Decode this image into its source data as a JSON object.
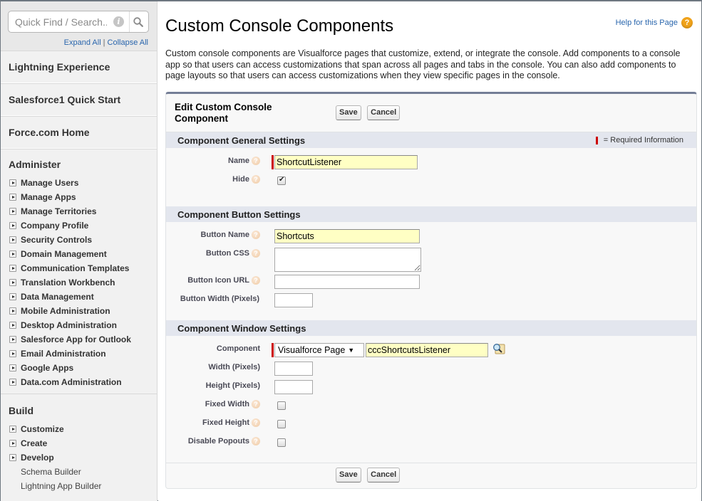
{
  "sidebar": {
    "search_placeholder": "Quick Find / Search...",
    "expand_all": "Expand All",
    "collapse_all": "Collapse All",
    "separator": "|",
    "top_links": [
      "Lightning Experience",
      "Salesforce1 Quick Start",
      "Force.com Home"
    ],
    "administer": {
      "title": "Administer",
      "items": [
        "Manage Users",
        "Manage Apps",
        "Manage Territories",
        "Company Profile",
        "Security Controls",
        "Domain Management",
        "Communication Templates",
        "Translation Workbench",
        "Data Management",
        "Mobile Administration",
        "Desktop Administration",
        "Salesforce App for Outlook",
        "Email Administration",
        "Google Apps",
        "Data.com Administration"
      ]
    },
    "build": {
      "title": "Build",
      "items": [
        "Customize",
        "Create",
        "Develop"
      ],
      "sub_items": [
        "Schema Builder",
        "Lightning App Builder"
      ]
    }
  },
  "header": {
    "title": "Custom Console Components",
    "help_link": "Help for this Page",
    "help_icon": "?",
    "intro": "Custom console components are Visualforce pages that customize, extend, or integrate the console. Add components to a console app so that users can access customizations that span across all pages and tabs in the console. You can also add components to page layouts so that users can access customizations when they view specific pages in the console."
  },
  "form": {
    "title": "Edit Custom Console Component",
    "save_label": "Save",
    "cancel_label": "Cancel",
    "required_legend": "= Required Information",
    "general": {
      "title": "Component General Settings",
      "name_label": "Name",
      "name_value": "ShortcutListener",
      "hide_label": "Hide",
      "hide_checked": true
    },
    "button": {
      "title": "Component Button Settings",
      "name_label": "Button Name",
      "name_value": "Shortcuts",
      "css_label": "Button CSS",
      "css_value": "",
      "icon_url_label": "Button Icon URL",
      "icon_url_value": "",
      "width_label": "Button Width (Pixels)",
      "width_value": ""
    },
    "window": {
      "title": "Component Window Settings",
      "component_label": "Component",
      "component_type": "Visualforce Page",
      "component_value": "cccShortcutsListener",
      "width_label": "Width (Pixels)",
      "width_value": "",
      "height_label": "Height (Pixels)",
      "height_value": "",
      "fixed_width_label": "Fixed Width",
      "fixed_width_checked": false,
      "fixed_height_label": "Fixed Height",
      "fixed_height_checked": false,
      "disable_popouts_label": "Disable Popouts",
      "disable_popouts_checked": false
    }
  },
  "colors": {
    "link": "#2a66ad",
    "required": "#cc0000",
    "section_bar": "#e3e6ee",
    "panel_border_top": "#747e96",
    "help_icon": "#f0a21a",
    "input_highlight": "#ffffc4"
  }
}
